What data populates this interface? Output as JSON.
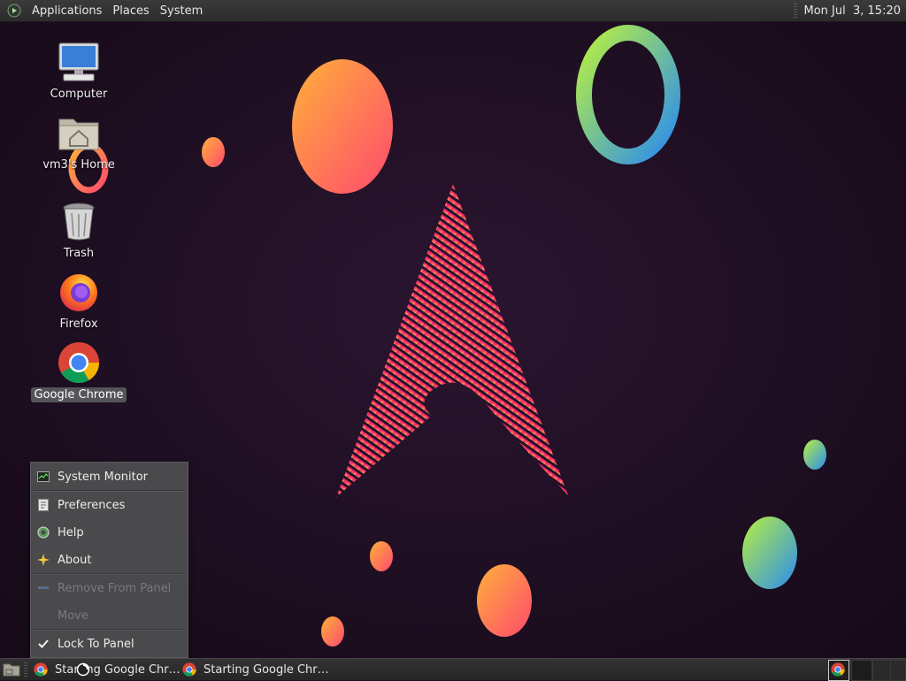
{
  "top_panel": {
    "menus": [
      "Applications",
      "Places",
      "System"
    ],
    "clock": "Mon Jul  3, 15:20"
  },
  "desktop_icons": [
    {
      "label": "Computer",
      "icon": "computer-icon"
    },
    {
      "label": "vm3's Home",
      "icon": "home-folder-icon"
    },
    {
      "label": "Trash",
      "icon": "trash-icon"
    },
    {
      "label": "Firefox",
      "icon": "firefox-icon"
    },
    {
      "label": "Google Chrome",
      "icon": "chrome-icon",
      "selected": true
    }
  ],
  "context_menu": {
    "items": [
      {
        "label": "System Monitor",
        "icon": "system-monitor-icon",
        "enabled": true
      },
      {
        "label": "Preferences",
        "icon": "preferences-icon",
        "enabled": true
      },
      {
        "label": "Help",
        "icon": "help-icon",
        "enabled": true
      },
      {
        "label": "About",
        "icon": "about-icon",
        "enabled": true
      },
      {
        "label": "Remove From Panel",
        "icon": "remove-icon",
        "enabled": false
      },
      {
        "label": "Move",
        "icon": "",
        "enabled": false
      },
      {
        "label": "Lock To Panel",
        "icon": "checkmark-icon",
        "enabled": true,
        "checked": true
      }
    ]
  },
  "taskbar": {
    "tasks": [
      {
        "label": "Starting Google Chr…",
        "icon": "chrome-icon"
      },
      {
        "label": "Starting Google Chr…",
        "icon": "chrome-icon"
      }
    ],
    "tray": [
      "chrome-icon"
    ]
  },
  "colors": {
    "background": "#1a0d1c",
    "panel": "#2c2c2c",
    "menu_bg": "#4a494c",
    "accent_pink": "#e0206a",
    "accent_orange": "#ff9a3c"
  }
}
